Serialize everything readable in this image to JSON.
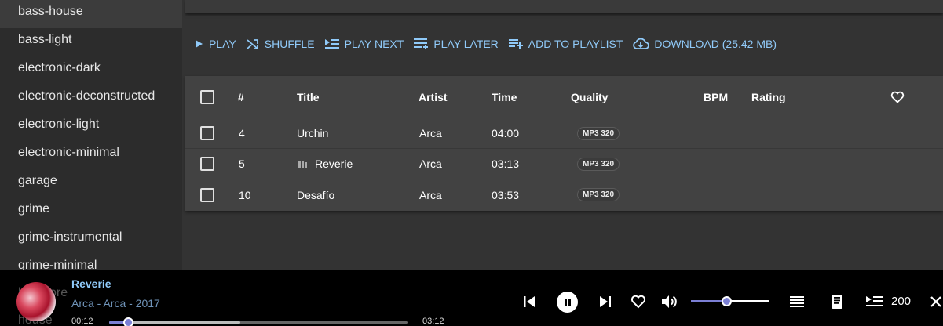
{
  "sidebar": {
    "genres": [
      {
        "label": "bass-house",
        "active": true
      },
      {
        "label": "bass-light"
      },
      {
        "label": "electronic-dark"
      },
      {
        "label": "electronic-deconstructed"
      },
      {
        "label": "electronic-light"
      },
      {
        "label": "electronic-minimal"
      },
      {
        "label": "garage"
      },
      {
        "label": "grime"
      },
      {
        "label": "grime-instrumental"
      },
      {
        "label": "grime-minimal"
      }
    ],
    "partially_hidden": [
      "hardcore",
      "house"
    ]
  },
  "actions": {
    "play": "PLAY",
    "shuffle": "SHUFFLE",
    "play_next": "PLAY NEXT",
    "play_later": "PLAY LATER",
    "add_to_playlist": "ADD TO PLAYLIST",
    "download": "DOWNLOAD (25.42 MB)"
  },
  "table": {
    "headers": {
      "num": "#",
      "title": "Title",
      "artist": "Artist",
      "time": "Time",
      "quality": "Quality",
      "bpm": "BPM",
      "rating": "Rating"
    },
    "rows": [
      {
        "num": "4",
        "title": "Urchin",
        "artist": "Arca",
        "time": "04:00",
        "quality": "MP3 320",
        "playing": false
      },
      {
        "num": "5",
        "title": "Reverie",
        "artist": "Arca",
        "time": "03:13",
        "quality": "MP3 320",
        "playing": true
      },
      {
        "num": "10",
        "title": "Desafío",
        "artist": "Arca",
        "time": "03:53",
        "quality": "MP3 320",
        "playing": false
      }
    ]
  },
  "player": {
    "title": "Reverie",
    "subtitle": "Arca - Arca - 2017",
    "current_time": "00:12",
    "total_time": "03:12",
    "progress": 0.063,
    "buffered": 0.44,
    "volume": 0.45,
    "queue_count": "200"
  },
  "colors": {
    "accent": "#90caf9",
    "slider": "#7b7fd4",
    "background": "#333333",
    "sidebar": "#2c2c2c",
    "player": "#000000"
  }
}
